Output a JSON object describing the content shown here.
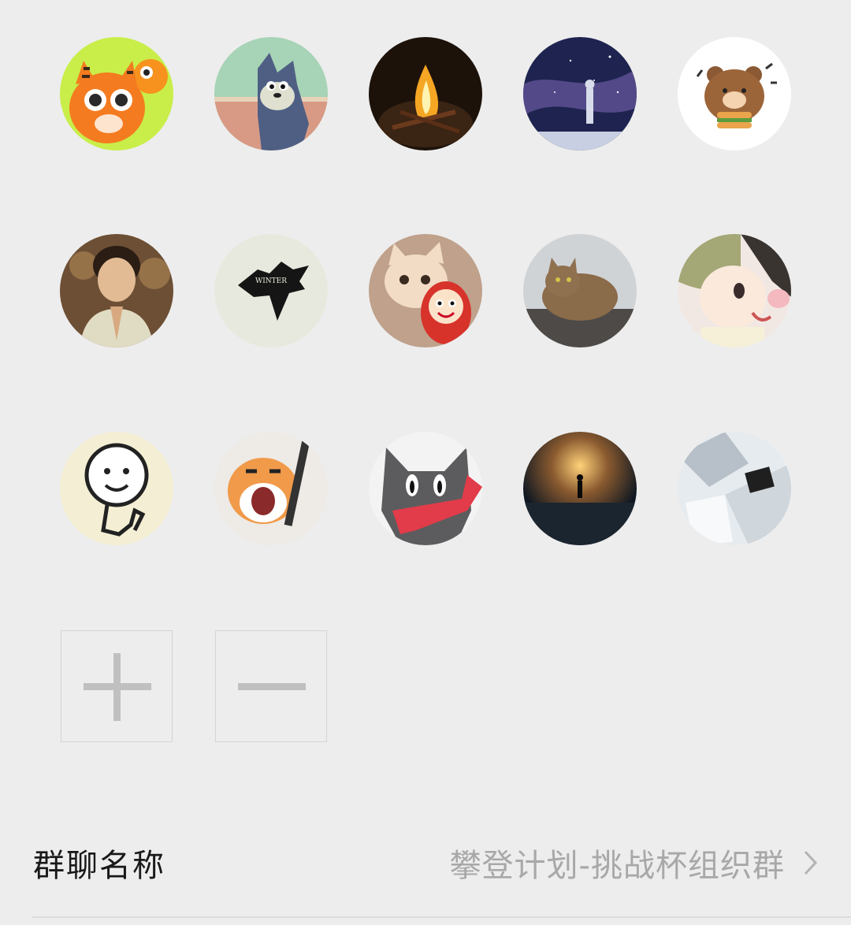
{
  "members": [
    {
      "icon": "tiger-cartoon-avatar"
    },
    {
      "icon": "tom-cat-cartoon-avatar"
    },
    {
      "icon": "campfire-photo-avatar"
    },
    {
      "icon": "starry-sky-person-avatar"
    },
    {
      "icon": "brown-bear-burger-avatar"
    },
    {
      "icon": "man-praying-portrait-avatar"
    },
    {
      "icon": "winter-is-coming-wolf-avatar"
    },
    {
      "icon": "cat-with-toy-avatar"
    },
    {
      "icon": "tabby-cat-photo-avatar"
    },
    {
      "icon": "anime-boy-avatar"
    },
    {
      "icon": "meme-doodle-avatar"
    },
    {
      "icon": "shouting-cat-meme-avatar"
    },
    {
      "icon": "black-cat-red-scarf-avatar"
    },
    {
      "icon": "silhouette-light-avatar"
    },
    {
      "icon": "silver-foil-avatar"
    }
  ],
  "add_button": {
    "icon": "plus-icon"
  },
  "remove_button": {
    "icon": "minus-icon"
  },
  "group_name": {
    "label": "群聊名称",
    "value": "攀登计划-挑战杯组织群",
    "icon": "chevron-right-icon"
  }
}
